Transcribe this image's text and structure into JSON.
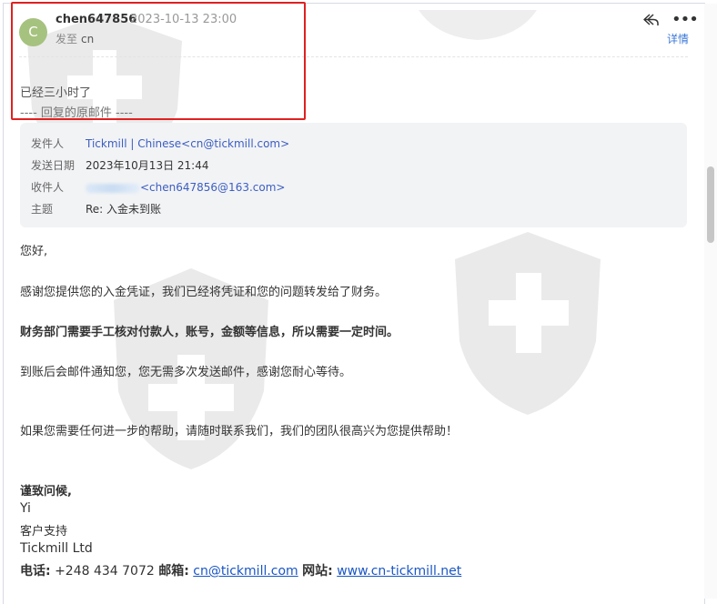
{
  "header": {
    "avatar_letter": "C",
    "sender": "chen647856",
    "date": "2023-10-13 23:00",
    "to_label": "发至",
    "to_value": "cn",
    "detail_label": "详情",
    "reply_icon": "reply-icon",
    "more_icon": "more-icon"
  },
  "reply": {
    "text": "已经三小时了",
    "separator": "---- 回复的原邮件 ----"
  },
  "original_meta": {
    "from_label": "发件人",
    "from_value": "Tickmill | Chinese<cn@tickmill.com>",
    "date_label": "发送日期",
    "date_value": "2023年10月13日 21:44",
    "to_label": "收件人",
    "to_value": "<chen647856@163.com>",
    "subject_label": "主题",
    "subject_value": "Re: 入金未到账"
  },
  "body": {
    "greeting": "您好,",
    "p1": "感谢您提供您的入金凭证，我们已经将凭证和您的问题转发给了财务。",
    "p2": "财务部门需要手工核对付款人，账号，金额等信息，所以需要一定时间。",
    "p3": "到账后会邮件通知您，您无需多次发送邮件，感谢您耐心等待。",
    "p4": "如果您需要任何进一步的帮助，请随时联系我们，我们的团队很高兴为您提供帮助！",
    "closing": "谨致问候,",
    "name": "Yi",
    "role": "客户支持",
    "company": "Tickmill Ltd",
    "phone_label": "电话:",
    "phone": "+248 434 7072",
    "email_label": "邮箱:",
    "email": "cn@tickmill.com",
    "site_label": "网站:",
    "site": "www.cn-tickmill.net"
  },
  "colors": {
    "accent": "#3b78d8",
    "highlight": "#e02020",
    "avatar": "#a6c27f"
  }
}
